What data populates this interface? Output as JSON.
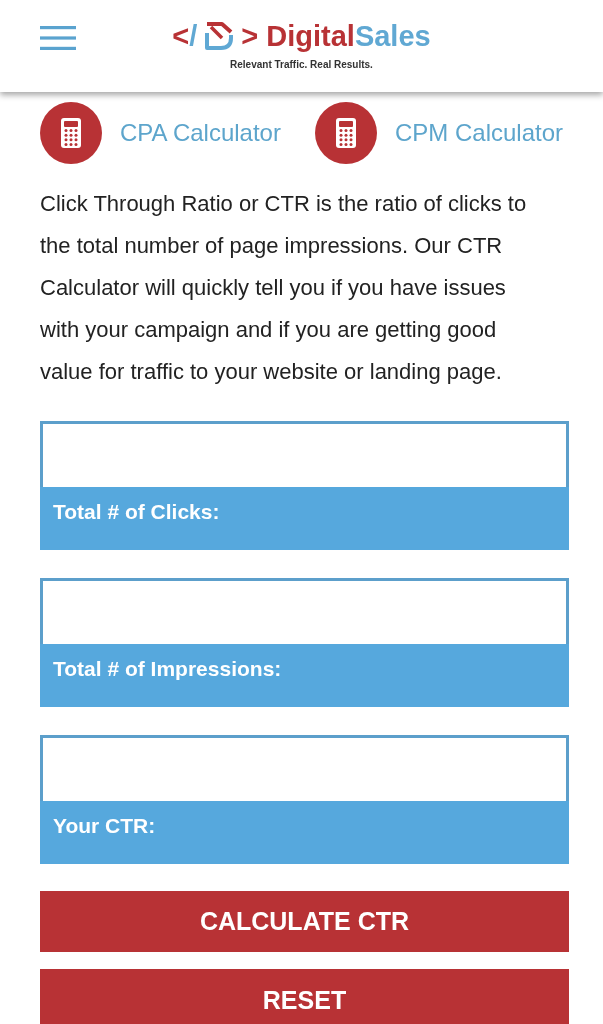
{
  "header": {
    "logo": {
      "code_open": [
        "<",
        "/"
      ],
      "code_close": ">",
      "brand_name": [
        "Digital",
        "Sales"
      ],
      "tagline": "Relevant Traffic. Real Results."
    }
  },
  "calculator_links": [
    {
      "label": "CPA Calculator"
    },
    {
      "label": "CPM Calculator"
    }
  ],
  "intro": "Click Through Ratio or CTR is the ratio of clicks to the total number of page impressions. Our CTR Calculator will quickly tell you if you have issues with your campaign and if you are getting good value for traffic to your website or landing page.",
  "fields": [
    {
      "label": "Total # of Clicks:"
    },
    {
      "label": "Total # of Impressions:"
    },
    {
      "label": "Your CTR:"
    }
  ],
  "buttons": [
    {
      "label": "CALCULATE CTR"
    },
    {
      "label": "RESET"
    }
  ]
}
